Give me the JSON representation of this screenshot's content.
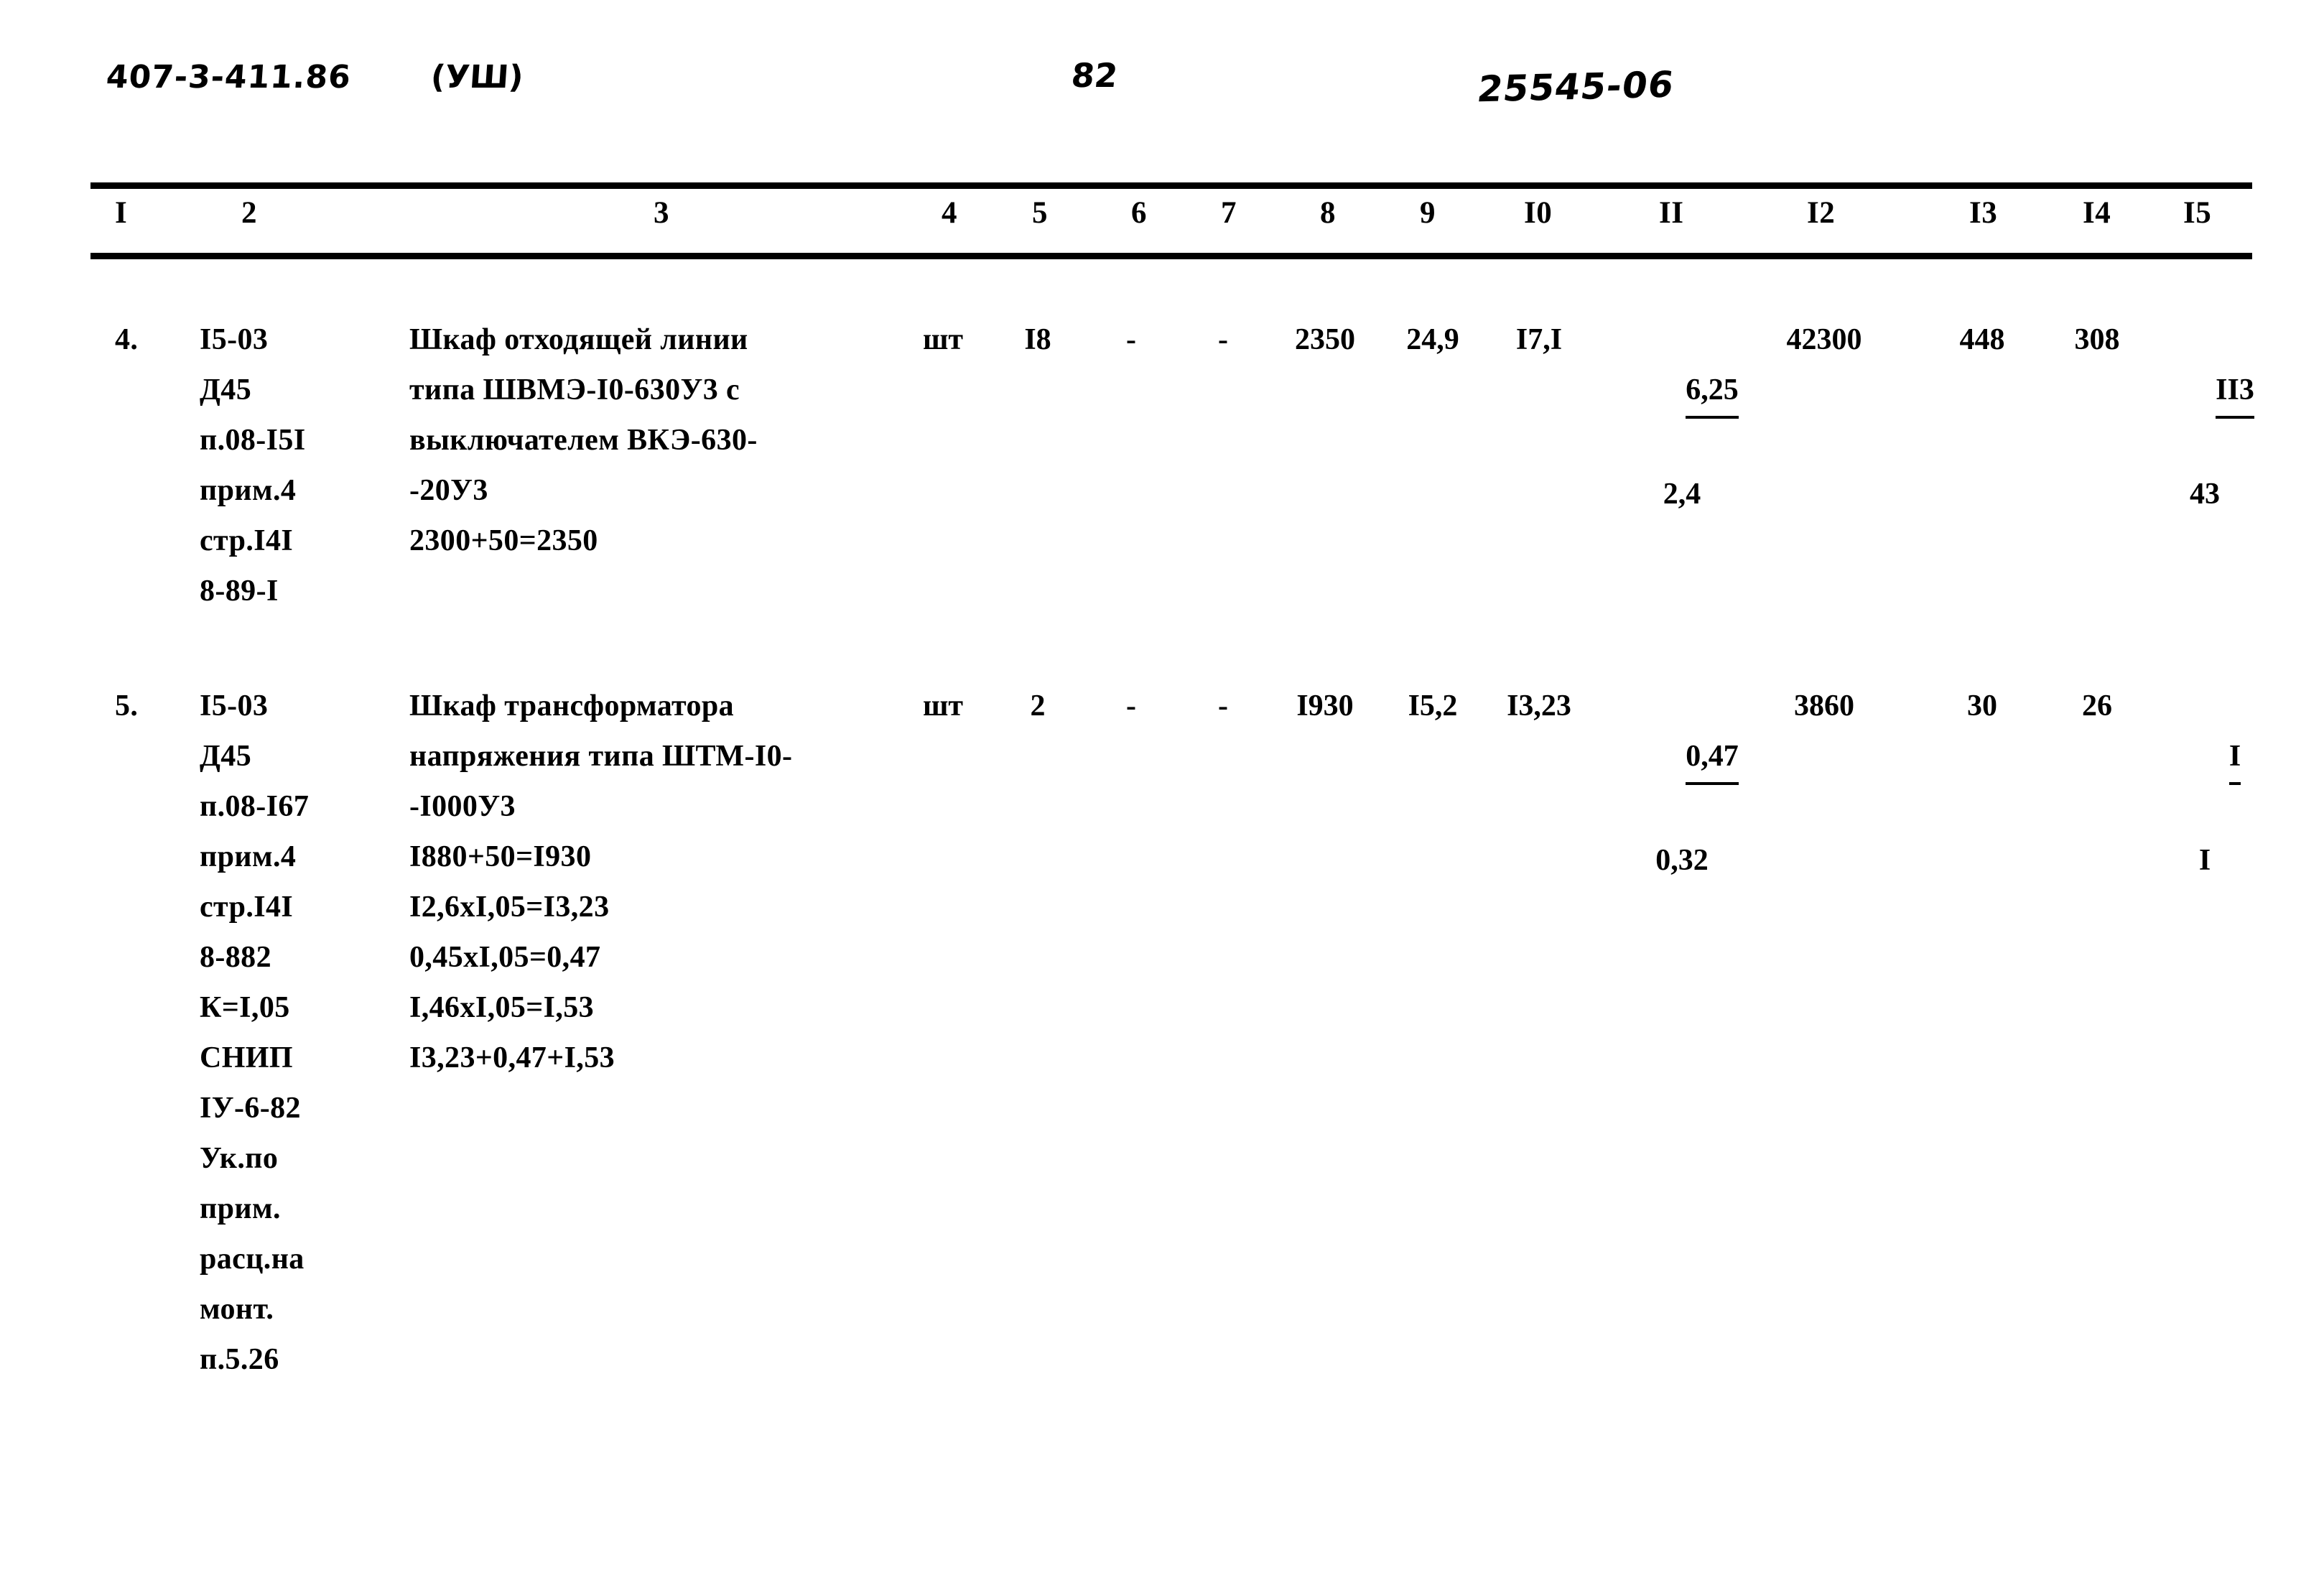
{
  "header": {
    "doc_code": "407-3-411.86",
    "series": "(УШ)",
    "page_number": "82",
    "stamp_code": "25545-06"
  },
  "table": {
    "column_headers": [
      "I",
      "2",
      "3",
      "4",
      "5",
      "6",
      "7",
      "8",
      "9",
      "I0",
      "II",
      "I2",
      "I3",
      "I4",
      "I5"
    ],
    "rows": [
      {
        "num": "4.",
        "col2": "I5-03\nД45\nп.08-I5I\nприм.4\nстр.I4I\n8-89-I",
        "col3": "Шкаф отходящей линии\nтипа ШВМЭ-I0-630У3 с\nвыключателем ВКЭ-630-\n-20У3\n2300+50=2350",
        "col4": "шт",
        "col5": "I8",
        "col6": "-",
        "col7": "-",
        "col8": "2350",
        "col9": "24,9",
        "col10": "I7,I",
        "col11_num": "6,25",
        "col11_den": "2,4",
        "col12": "42300",
        "col13": "448",
        "col14": "308",
        "col15_num": "II3",
        "col15_den": "43"
      },
      {
        "num": "5.",
        "col2": "I5-03\nД45\nп.08-I67\nприм.4\nстр.I4I\n8-882\nК=I,05\nСНИП\nIУ-6-82\nУк.по\nприм.\nрасц.на\nмонт.\nп.5.26",
        "col3": "Шкаф трансформатора\nнапряжения типа ШТМ-I0-\n-I000У3\nI880+50=I930\nI2,6xI,05=I3,23\n0,45xI,05=0,47\nI,46xI,05=I,53\nI3,23+0,47+I,53",
        "col4": "шт",
        "col5": "2",
        "col6": "-",
        "col7": "-",
        "col8": "I930",
        "col9": "I5,2",
        "col10": "I3,23",
        "col11_num": "0,47",
        "col11_den": "0,32",
        "col12": "3860",
        "col13": "30",
        "col14": "26",
        "col15_num": "I",
        "col15_den": "I"
      }
    ]
  }
}
